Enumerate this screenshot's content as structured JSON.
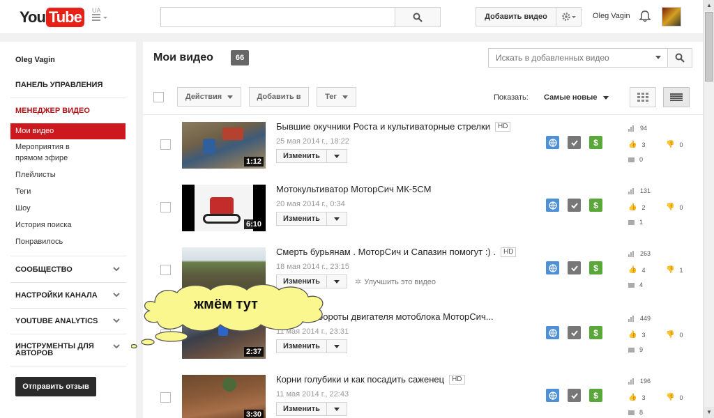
{
  "header": {
    "logo_you": "You",
    "logo_tube": "Tube",
    "logo_region": "UA",
    "search_placeholder": "",
    "upload_label": "Добавить видео",
    "user_name": "Oleg Vagin"
  },
  "sidebar": {
    "user": "Oleg Vagin",
    "dashboard": "ПАНЕЛЬ УПРАВЛЕНИЯ",
    "video_manager": "МЕНЕДЖЕР ВИДЕО",
    "items": [
      {
        "label": "Мои видео"
      },
      {
        "label": "Мероприятия в прямом эфире"
      },
      {
        "label": "Плейлисты"
      },
      {
        "label": "Теги"
      },
      {
        "label": "Шоу"
      },
      {
        "label": "История поиска"
      },
      {
        "label": "Понравилось"
      }
    ],
    "sections": [
      {
        "label": "СООБЩЕСТВО"
      },
      {
        "label": "НАСТРОЙКИ КАНАЛА"
      },
      {
        "label": "YOUTUBE ANALYTICS"
      },
      {
        "label": "ИНСТРУМЕНТЫ ДЛЯ АВТОРОВ"
      }
    ],
    "feedback_label": "Отправить отзыв"
  },
  "main": {
    "title": "Мои видео",
    "count": "66",
    "search_placeholder": "Искать в добавленных видео",
    "actions_label": "Действия",
    "add_to_label": "Добавить в",
    "tag_label": "Тег",
    "show_label": "Показать:",
    "sort_value": "Самые новые"
  },
  "videos": [
    {
      "title": "Бывшие окучники Роста и культиваторные стрелки",
      "hd": "HD",
      "date": "25 мая 2014 г., 18:22",
      "duration": "1:12",
      "views": "94",
      "likes": "3",
      "dislikes": "0",
      "comments": "0",
      "edit": "Изменить",
      "improve": ""
    },
    {
      "title": "Мотокультиватор МоторСич МК-5СМ",
      "hd": "",
      "date": "20 мая 2014 г., 0:34",
      "duration": "6:10",
      "views": "131",
      "likes": "2",
      "dislikes": "0",
      "comments": "1",
      "edit": "Изменить",
      "improve": ""
    },
    {
      "title": "Смерть бурьянам . МоторСич и Сапазин помогут :) .",
      "hd": "HD",
      "date": "18 мая 2014 г., 23:15",
      "duration": "",
      "views": "263",
      "likes": "4",
      "dislikes": "1",
      "comments": "4",
      "edit": "Изменить",
      "improve": "Улучшить это видео"
    },
    {
      "title": "...льные обороты двигателя мотоблока МоторСич...",
      "hd": "",
      "date": "11 мая 2014 г., 23:31",
      "duration": "2:37",
      "views": "449",
      "likes": "3",
      "dislikes": "0",
      "comments": "9",
      "edit": "Изменить",
      "improve": ""
    },
    {
      "title": "Корни голубики и как посадить саженец",
      "hd": "HD",
      "date": "11 мая 2014 г., 22:43",
      "duration": "3:30",
      "views": "196",
      "likes": "3",
      "dislikes": "0",
      "comments": "8",
      "edit": "Изменить",
      "improve": ""
    }
  ],
  "callout": {
    "text": "жмём тут"
  },
  "colors": {
    "brand_red": "#cc181e",
    "globe": "#4d90d6",
    "check": "#777777",
    "money": "#5aa83a"
  },
  "icons": [
    "search-icon",
    "hamburger-icon",
    "gear-icon",
    "bell-icon",
    "chevron-down-icon",
    "globe-icon",
    "check-icon",
    "dollar-icon",
    "views-icon",
    "like-icon",
    "dislike-icon",
    "comment-icon",
    "grid-view-icon",
    "list-view-icon",
    "wand-icon"
  ]
}
